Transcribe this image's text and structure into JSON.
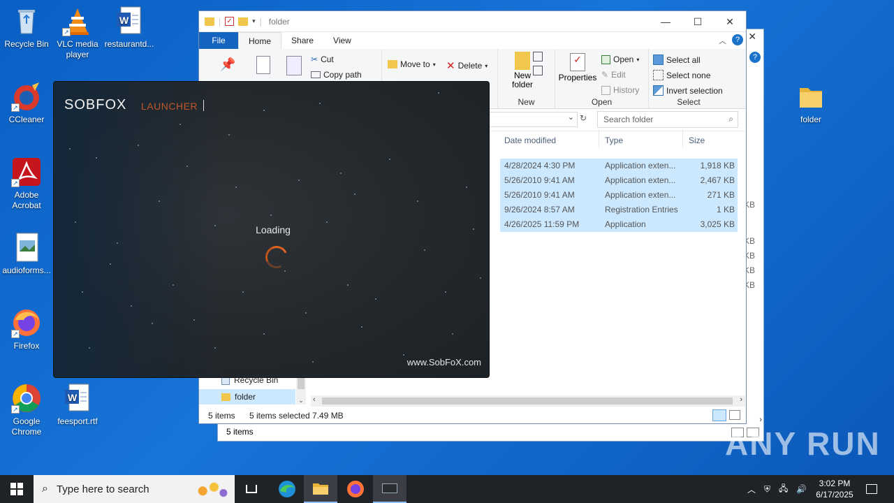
{
  "desktop": {
    "icons": [
      {
        "label": "Recycle Bin"
      },
      {
        "label": "VLC media player"
      },
      {
        "label": "restaurantd..."
      },
      {
        "label": "CCleaner"
      },
      {
        "label": "Adobe Acrobat"
      },
      {
        "label": "audioforms..."
      },
      {
        "label": "Firefox"
      },
      {
        "label": "Google Chrome"
      },
      {
        "label": "feesport.rtf"
      },
      {
        "label": "folder"
      }
    ]
  },
  "back_window": {
    "status_items": "5 items",
    "size_partial": [
      "KB",
      "KB",
      "KB",
      "KB",
      "KB"
    ]
  },
  "explorer": {
    "title": "folder",
    "tabs": [
      "File",
      "Home",
      "Share",
      "View"
    ],
    "ribbon": {
      "clipboard": {
        "cut": "Cut",
        "copy_path": "Copy path"
      },
      "organize": {
        "move_to": "Move to",
        "delete": "Delete"
      },
      "new": {
        "new_folder": "New folder",
        "group": "New"
      },
      "open": {
        "properties": "Properties",
        "open": "Open",
        "edit": "Edit",
        "history": "History",
        "group": "Open"
      },
      "select": {
        "select_all": "Select all",
        "select_none": "Select none",
        "invert": "Invert selection",
        "group": "Select"
      }
    },
    "search_placeholder": "Search folder",
    "columns": {
      "date": "Date modified",
      "type": "Type",
      "size": "Size"
    },
    "rows": [
      {
        "date": "4/28/2024 4:30 PM",
        "type": "Application exten...",
        "size": "1,918 KB"
      },
      {
        "date": "5/26/2010 9:41 AM",
        "type": "Application exten...",
        "size": "2,467 KB"
      },
      {
        "date": "5/26/2010 9:41 AM",
        "type": "Application exten...",
        "size": "271 KB"
      },
      {
        "date": "9/26/2024 8:57 AM",
        "type": "Registration Entries",
        "size": "1 KB"
      },
      {
        "date": "4/26/2025 11:59 PM",
        "type": "Application",
        "size": "3,025 KB"
      }
    ],
    "nav": [
      {
        "label": "Recycle Bin"
      },
      {
        "label": "folder"
      }
    ],
    "status": {
      "items": "5 items",
      "selected": "5 items selected",
      "size": "7.49 MB"
    }
  },
  "launcher": {
    "brand": "SOBFOX",
    "section": "LAUNCHER",
    "loading": "Loading",
    "site": "www.SobFoX.com"
  },
  "taskbar": {
    "search_placeholder": "Type here to search",
    "time": "3:02 PM",
    "date": "6/17/2025"
  },
  "watermark": "ANY RUN"
}
